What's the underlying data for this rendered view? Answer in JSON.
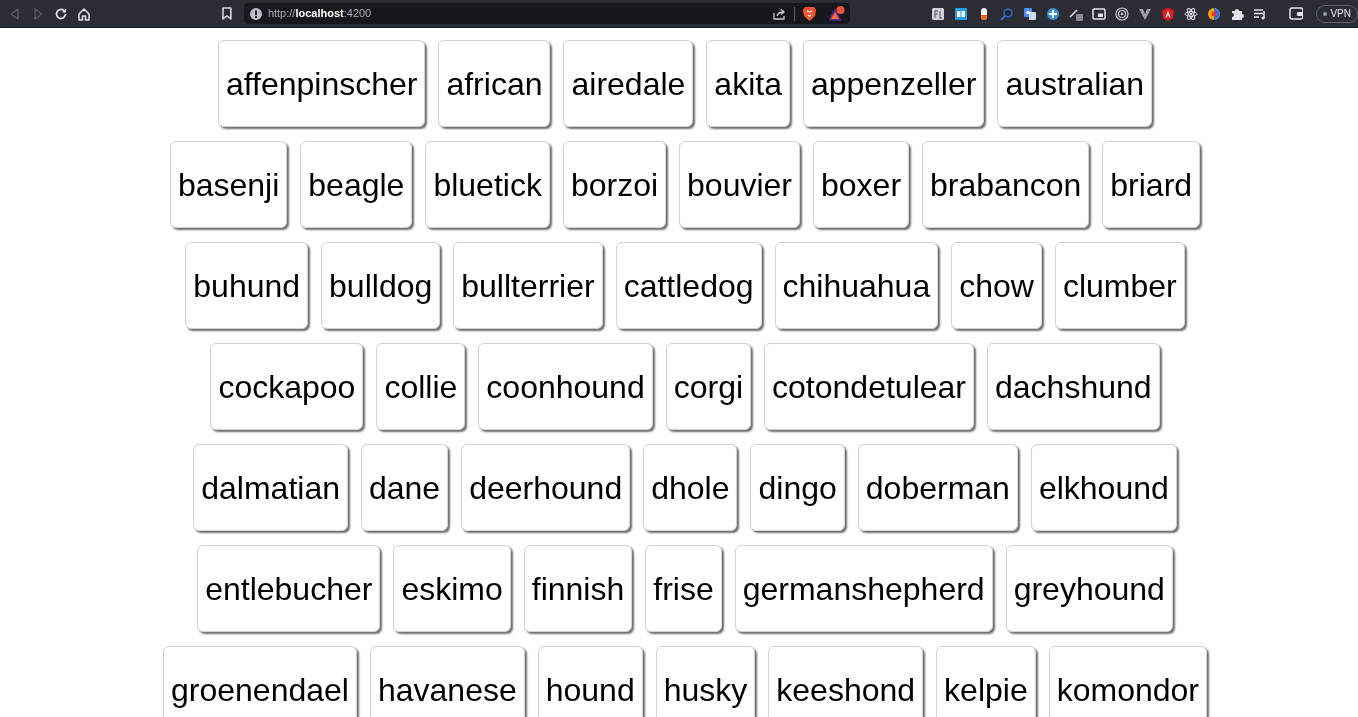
{
  "browser": {
    "back": {
      "disabled": true
    },
    "forward": {
      "disabled": true
    },
    "url": "http://**localhost**:4200",
    "vpn_label": "VPN"
  },
  "breeds": [
    "affenpinscher",
    "african",
    "airedale",
    "akita",
    "appenzeller",
    "australian",
    "basenji",
    "beagle",
    "bluetick",
    "borzoi",
    "bouvier",
    "boxer",
    "brabancon",
    "briard",
    "buhund",
    "bulldog",
    "bullterrier",
    "cattledog",
    "chihuahua",
    "chow",
    "clumber",
    "cockapoo",
    "collie",
    "coonhound",
    "corgi",
    "cotondetulear",
    "dachshund",
    "dalmatian",
    "dane",
    "deerhound",
    "dhole",
    "dingo",
    "doberman",
    "elkhound",
    "entlebucher",
    "eskimo",
    "finnish",
    "frise",
    "germanshepherd",
    "greyhound",
    "groenendael",
    "havanese",
    "hound",
    "husky",
    "keeshond",
    "kelpie",
    "komondor"
  ]
}
